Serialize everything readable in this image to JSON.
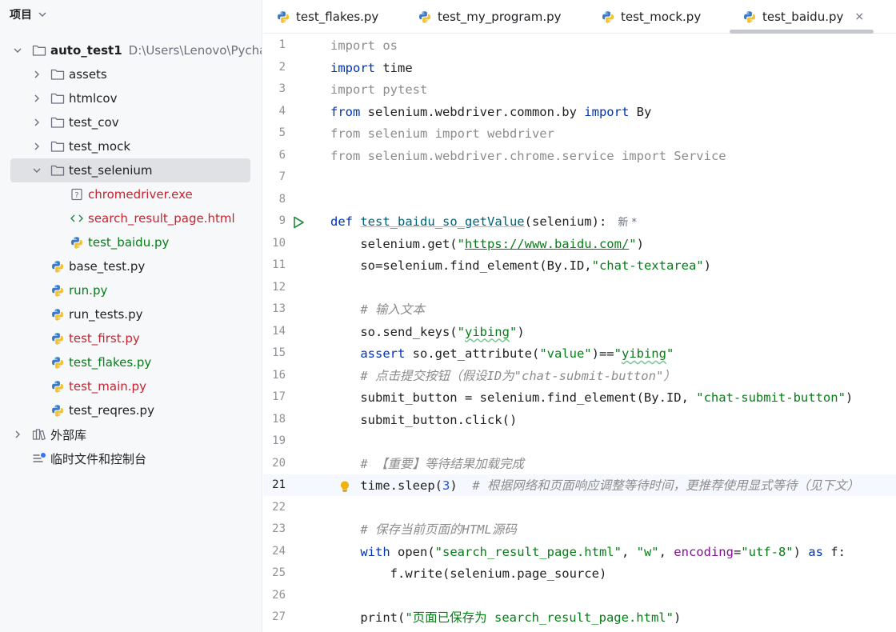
{
  "sidebar": {
    "title": "项目",
    "tree": [
      {
        "label": "auto_test1",
        "path": "D:\\Users\\Lenovo\\Pycharm",
        "icon": "folder-icon",
        "expanded": true,
        "depth": 0,
        "color": "#1e1f22",
        "bold": true
      },
      {
        "label": "assets",
        "icon": "folder-icon",
        "expanded": false,
        "depth": 1,
        "color": "#1e1f22"
      },
      {
        "label": "htmlcov",
        "icon": "folder-icon",
        "expanded": false,
        "depth": 1,
        "color": "#1e1f22"
      },
      {
        "label": "test_cov",
        "icon": "folder-icon",
        "expanded": false,
        "depth": 1,
        "color": "#1e1f22"
      },
      {
        "label": "test_mock",
        "icon": "folder-icon",
        "expanded": false,
        "depth": 1,
        "color": "#1e1f22"
      },
      {
        "label": "test_selenium",
        "icon": "folder-icon",
        "expanded": true,
        "depth": 1,
        "color": "#1e1f22",
        "selected": true
      },
      {
        "label": "chromedriver.exe",
        "icon": "unknown-file-icon",
        "depth": 2,
        "color": "#c7222d"
      },
      {
        "label": "search_result_page.html",
        "icon": "html-file-icon",
        "depth": 2,
        "color": "#c7222d"
      },
      {
        "label": "test_baidu.py",
        "icon": "python-file-icon",
        "depth": 2,
        "color": "#067d17"
      },
      {
        "label": "base_test.py",
        "icon": "python-file-icon",
        "depth": 1,
        "color": "#1e1f22"
      },
      {
        "label": "run.py",
        "icon": "python-file-icon",
        "depth": 1,
        "color": "#067d17"
      },
      {
        "label": "run_tests.py",
        "icon": "python-file-icon",
        "depth": 1,
        "color": "#1e1f22"
      },
      {
        "label": "test_first.py",
        "icon": "python-file-icon",
        "depth": 1,
        "color": "#c7222d"
      },
      {
        "label": "test_flakes.py",
        "icon": "python-file-icon",
        "depth": 1,
        "color": "#067d17"
      },
      {
        "label": "test_main.py",
        "icon": "python-file-icon",
        "depth": 1,
        "color": "#c7222d"
      },
      {
        "label": "test_reqres.py",
        "icon": "python-file-icon",
        "depth": 1,
        "color": "#1e1f22"
      },
      {
        "label": "外部库",
        "icon": "library-icon",
        "expanded": false,
        "depth": 0,
        "color": "#1e1f22"
      },
      {
        "label": "临时文件和控制台",
        "icon": "scratches-icon",
        "depth": 0,
        "color": "#1e1f22",
        "no_arrow": true
      }
    ]
  },
  "tabs": [
    {
      "label": "test_flakes.py",
      "active": false
    },
    {
      "label": "test_my_program.py",
      "active": false
    },
    {
      "label": "test_mock.py",
      "active": false
    },
    {
      "label": "test_baidu.py",
      "active": true,
      "close": "×"
    }
  ],
  "editor": {
    "current_line": 21,
    "hint_after_line_9": "新 *",
    "lines": [
      {
        "n": "1",
        "html": "<span class='kw-dim'>import</span><span class='dim'> os</span>"
      },
      {
        "n": "2",
        "html": "<span class='kw'>import</span> time"
      },
      {
        "n": "3",
        "html": "<span class='kw-dim'>import</span><span class='dim'> pytest</span>"
      },
      {
        "n": "4",
        "html": "<span class='kw'>from</span> selenium.webdriver.common.by <span class='kw'>import</span> By"
      },
      {
        "n": "5",
        "html": "<span class='kw-dim'>from</span><span class='dim'> selenium </span><span class='kw-dim'>import</span><span class='dim'> webdriver</span>"
      },
      {
        "n": "6",
        "html": "<span class='kw-dim'>from</span><span class='dim'> selenium.webdriver.chrome.service </span><span class='kw-dim'>import</span><span class='dim'> Service</span>"
      },
      {
        "n": "7",
        "html": ""
      },
      {
        "n": "8",
        "html": ""
      },
      {
        "n": "9",
        "html": "<span class='kw'>def</span> <span class='fn'>test_baidu_so_getValue</span>(selenium):<span class='hint'>新 *</span>"
      },
      {
        "n": "10",
        "html": "    selenium.get(<span class='str'>\"<span class='link'>https://www.baidu.com/</span>\"</span>)"
      },
      {
        "n": "11",
        "html": "    so=selenium.find_element(By.ID,<span class='str'>\"chat-textarea\"</span>)"
      },
      {
        "n": "12",
        "html": ""
      },
      {
        "n": "13",
        "html": "    <span class='cmt'># 输入文本</span>"
      },
      {
        "n": "14",
        "html": "    so.send_keys(<span class='str'>\"<span class='squig'>yibing</span>\"</span>)"
      },
      {
        "n": "15",
        "html": "    <span class='kw'>assert</span> so.get_attribute(<span class='str'>\"value\"</span>)==<span class='str'>\"<span class='squig'>yibing</span>\"</span>"
      },
      {
        "n": "16",
        "html": "    <span class='cmt'># 点击提交按钮（假设ID为\"chat-submit-button\"）</span>"
      },
      {
        "n": "17",
        "html": "    submit_button = selenium.find_element(By.ID, <span class='str'>\"chat-submit-button\"</span>)"
      },
      {
        "n": "18",
        "html": "    submit_button.click()"
      },
      {
        "n": "19",
        "html": ""
      },
      {
        "n": "20",
        "html": "    <span class='cmt'># 【重要】等待结果加载完成</span>"
      },
      {
        "n": "21",
        "html": "    time.sleep(<span class='num'>3</span>)  <span class='cmt'># 根据网络和页面响应调整等待时间，更推荐使用显式等待（见下文）</span>"
      },
      {
        "n": "22",
        "html": ""
      },
      {
        "n": "23",
        "html": "    <span class='cmt'># 保存当前页面的HTML源码</span>"
      },
      {
        "n": "24",
        "html": "    <span class='kw'>with</span> open(<span class='str'>\"search_result_page.html\"</span>, <span class='str'>\"w\"</span>, <span class='prm'>encoding</span>=<span class='str'>\"utf-8\"</span>) <span class='kw'>as</span> f:"
      },
      {
        "n": "25",
        "html": "        f.write(selenium.page_source)"
      },
      {
        "n": "26",
        "html": ""
      },
      {
        "n": "27",
        "html": "    print(<span class='str'>\"页面已保存为 search_result_page.html\"</span>)"
      }
    ]
  },
  "colors": {
    "accent": "#0033b3",
    "string": "#067d17",
    "selection": "#dfe1e5",
    "current_line": "#f5f8fe",
    "run_icon": "#208a3c",
    "bulb": "#f2b20c"
  }
}
